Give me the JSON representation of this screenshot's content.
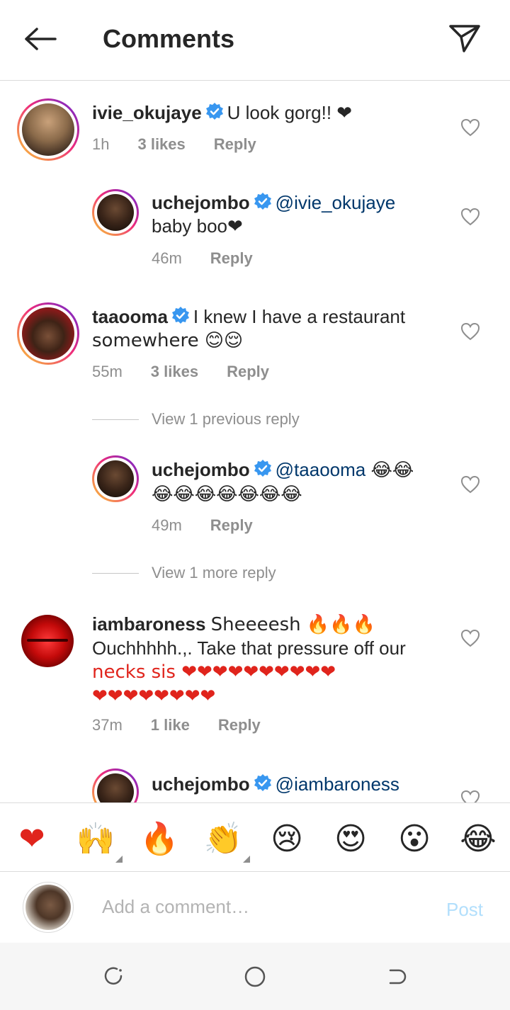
{
  "header": {
    "title": "Comments",
    "back_icon": "arrow-left-icon",
    "send_icon": "paper-plane-icon"
  },
  "comments": [
    {
      "username": "ivie_okujaye",
      "text": "U look gorg!! ❤",
      "time": "1h",
      "likes": "3 likes",
      "reply": "Reply"
    },
    {
      "username": "uchejombo",
      "mention": "@ivie_okujaye",
      "text": "baby boo❤",
      "time": "46m",
      "reply": "Reply"
    },
    {
      "username": "taaooma",
      "text_line1": "I knew I have a restaurant",
      "text_line2": "somewhere 😊😌",
      "time": "55m",
      "likes": "3 likes",
      "reply": "Reply"
    },
    {
      "view_replies": "View 1 previous reply"
    },
    {
      "username": "uchejombo",
      "mention": "@taaooma",
      "text_line1": "😂😂",
      "text_line2": "😂😂😂😂😂😂😂",
      "time": "49m",
      "reply": "Reply"
    },
    {
      "view_replies": "View 1 more reply"
    },
    {
      "username": "iambaroness",
      "text_line1": "Sheeeesh 🔥🔥🔥",
      "text_line2": "Ouchhhhh.,. Take that pressure off  our",
      "text_line3": "necks sis ❤❤❤❤❤❤❤❤❤❤",
      "text_line4": "❤❤❤❤❤❤❤❤",
      "time": "37m",
      "likes": "1 like",
      "reply": "Reply"
    },
    {
      "username": "uchejombo",
      "mention": "@iambaroness"
    }
  ],
  "emoji_bar": [
    {
      "glyph": "❤",
      "name": "red-heart"
    },
    {
      "glyph": "🙌",
      "name": "raising-hands"
    },
    {
      "glyph": "🔥",
      "name": "fire"
    },
    {
      "glyph": "👏",
      "name": "clapping-hands"
    },
    {
      "glyph": "😢",
      "name": "crying-face"
    },
    {
      "glyph": "😍",
      "name": "heart-eyes"
    },
    {
      "glyph": "😮",
      "name": "surprised-face"
    },
    {
      "glyph": "😂",
      "name": "tears-of-joy"
    }
  ],
  "composer": {
    "placeholder": "Add a comment…",
    "post_label": "Post"
  },
  "colors": {
    "accent_link": "#00376b",
    "verified_blue": "#3897f0",
    "post_disabled": "#b2dffc",
    "meta_gray": "#8e8e8e"
  }
}
